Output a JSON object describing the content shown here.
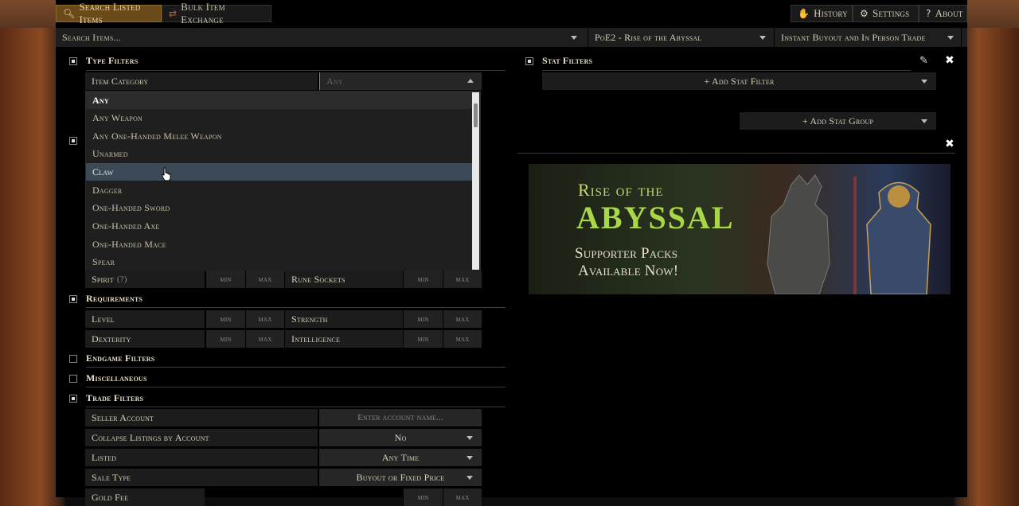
{
  "header": {
    "tab_search": "Search Listed Items",
    "tab_bulk": "Bulk Item Exchange",
    "history": "History",
    "settings": "Settings",
    "about": "About"
  },
  "search": {
    "placeholder": "Search Items...",
    "league": "PoE2 - Rise of the Abyssal",
    "trade_mode": "Instant Buyout and In Person Trade"
  },
  "type_filters": {
    "title": "Type Filters",
    "item_category_label": "Item Category",
    "item_category_placeholder": "Any",
    "options": [
      "Any",
      "Any Weapon",
      "Any One-Handed Melee Weapon",
      "Unarmed",
      "Claw",
      "Dagger",
      "One-Handed Sword",
      "One-Handed Axe",
      "One-Handed Mace",
      "Spear"
    ]
  },
  "min_label": "min",
  "max_label": "max",
  "equipment_rows": {
    "spirit": "Spirit",
    "spirit_hint": "(?)",
    "rune_sockets": "Rune Sockets"
  },
  "requirements": {
    "title": "Requirements",
    "level": "Level",
    "strength": "Strength",
    "dexterity": "Dexterity",
    "intelligence": "Intelligence"
  },
  "endgame_filters": "Endgame Filters",
  "miscellaneous": "Miscellaneous",
  "trade_filters": {
    "title": "Trade Filters",
    "seller_account": "Seller Account",
    "seller_placeholder": "Enter account name...",
    "collapse_label": "Collapse Listings by Account",
    "collapse_value": "No",
    "listed_label": "Listed",
    "listed_value": "Any Time",
    "sale_type_label": "Sale Type",
    "sale_type_value": "Buyout or Fixed Price",
    "gold_fee_label": "Gold Fee"
  },
  "stat_filters": {
    "title": "Stat Filters",
    "add_stat_filter": "+ Add Stat Filter",
    "add_stat_group": "+ Add Stat Group"
  },
  "banner": {
    "line1": "Rise of the",
    "line2": "Abyssal",
    "line3": "Supporter Packs",
    "line4": "Available Now!"
  }
}
